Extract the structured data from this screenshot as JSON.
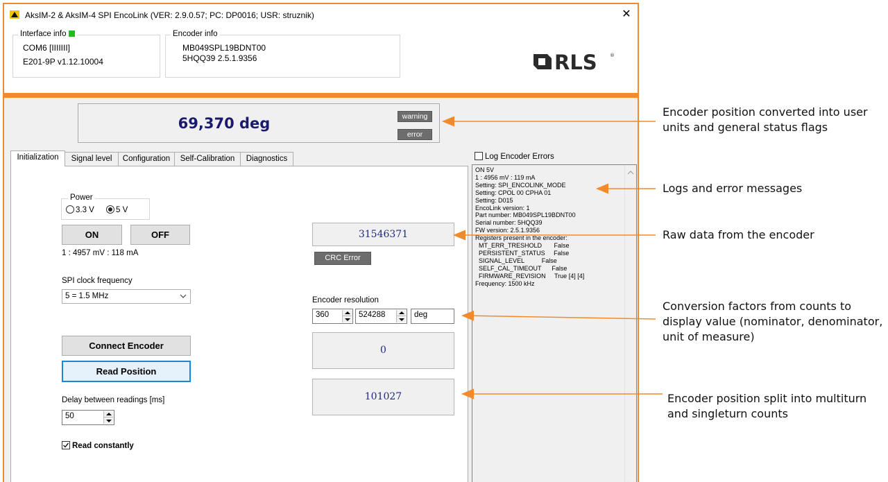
{
  "window": {
    "title": "AksIM-2 & AksIM-4 SPI EncoLink (VER: 2.9.0.57; PC: DP0016; USR: struznik)",
    "close_glyph": "✕"
  },
  "interface_info": {
    "legend": "Interface info",
    "status_color": "#22bb22",
    "port": "COM6  [IIIIIII]",
    "firmware": "E201-9P v1.12.10004"
  },
  "encoder_info": {
    "legend": "Encoder info",
    "part_number": "MB049SPL19BDNT00",
    "serial_version": "5HQQ39   2.5.1.9356"
  },
  "logo": {
    "text": "RLS",
    "registered": "®"
  },
  "position": {
    "value": "69,370 deg",
    "warning_label": "warning",
    "error_label": "error"
  },
  "tabs": [
    {
      "label": "Initialization",
      "active": true
    },
    {
      "label": "Signal level",
      "active": false
    },
    {
      "label": "Configuration",
      "active": false
    },
    {
      "label": "Self-Calibration",
      "active": false
    },
    {
      "label": "Diagnostics",
      "active": false
    }
  ],
  "power": {
    "legend": "Power",
    "option_33v": "3.3 V",
    "option_5v": "5 V",
    "selected": "5 V",
    "on_label": "ON",
    "off_label": "OFF",
    "readout": "1 : 4957 mV : 118 mA"
  },
  "spi": {
    "label": "SPI clock frequency",
    "selected": "5 = 1.5 MHz"
  },
  "raw_data": {
    "value": "31546371",
    "crc_label": "CRC Error"
  },
  "resolution": {
    "label": "Encoder resolution",
    "nominator": "360",
    "denominator": "524288",
    "unit": "deg"
  },
  "counts": {
    "multiturn": "0",
    "singleturn": "101027"
  },
  "actions": {
    "connect_label": "Connect Encoder",
    "read_label": "Read Position",
    "delay_label": "Delay between readings [ms]",
    "delay_value": "50",
    "read_constantly_label": "Read constantly",
    "read_constantly_checked": true
  },
  "log": {
    "checkbox_label": "Log Encoder Errors",
    "checked": false,
    "lines": "ON 5V\n1 : 4956 mV : 119 mA\nSetting: SPI_ENCOLINK_MODE\nSetting: CPOL 00 CPHA 01\nSetting: D015\nEncoLink version: 1\nPart number: MB049SPL19BDNT00\nSerial number: 5HQQ39\nFW version: 2.5.1.9356\nRegisters present in the encoder:\n  MT_ERR_TRESHOLD       False\n  PERSISTENT_STATUS     False\n  SIGNAL_LEVEL          False\n  SELF_CAL_TIMEOUT      False\n  FIRMWARE_REVISION     True [4] [4]\nFrequency: 1500 kHz"
  },
  "annotations": [
    {
      "text": "Encoder position converted into user units and general status flags"
    },
    {
      "text": "Logs and error messages"
    },
    {
      "text": "Raw data from the encoder"
    },
    {
      "text": "Conversion factors from counts to display value (nominator, denominator, unit of measure)"
    },
    {
      "text": "Encoder position split into multiturn and singleturn counts"
    }
  ],
  "colors": {
    "accent_orange": "#f08a2c",
    "position_text": "#1a1a6e",
    "readout_text": "#1f2a80",
    "flag_bg": "#6d6d6d"
  }
}
